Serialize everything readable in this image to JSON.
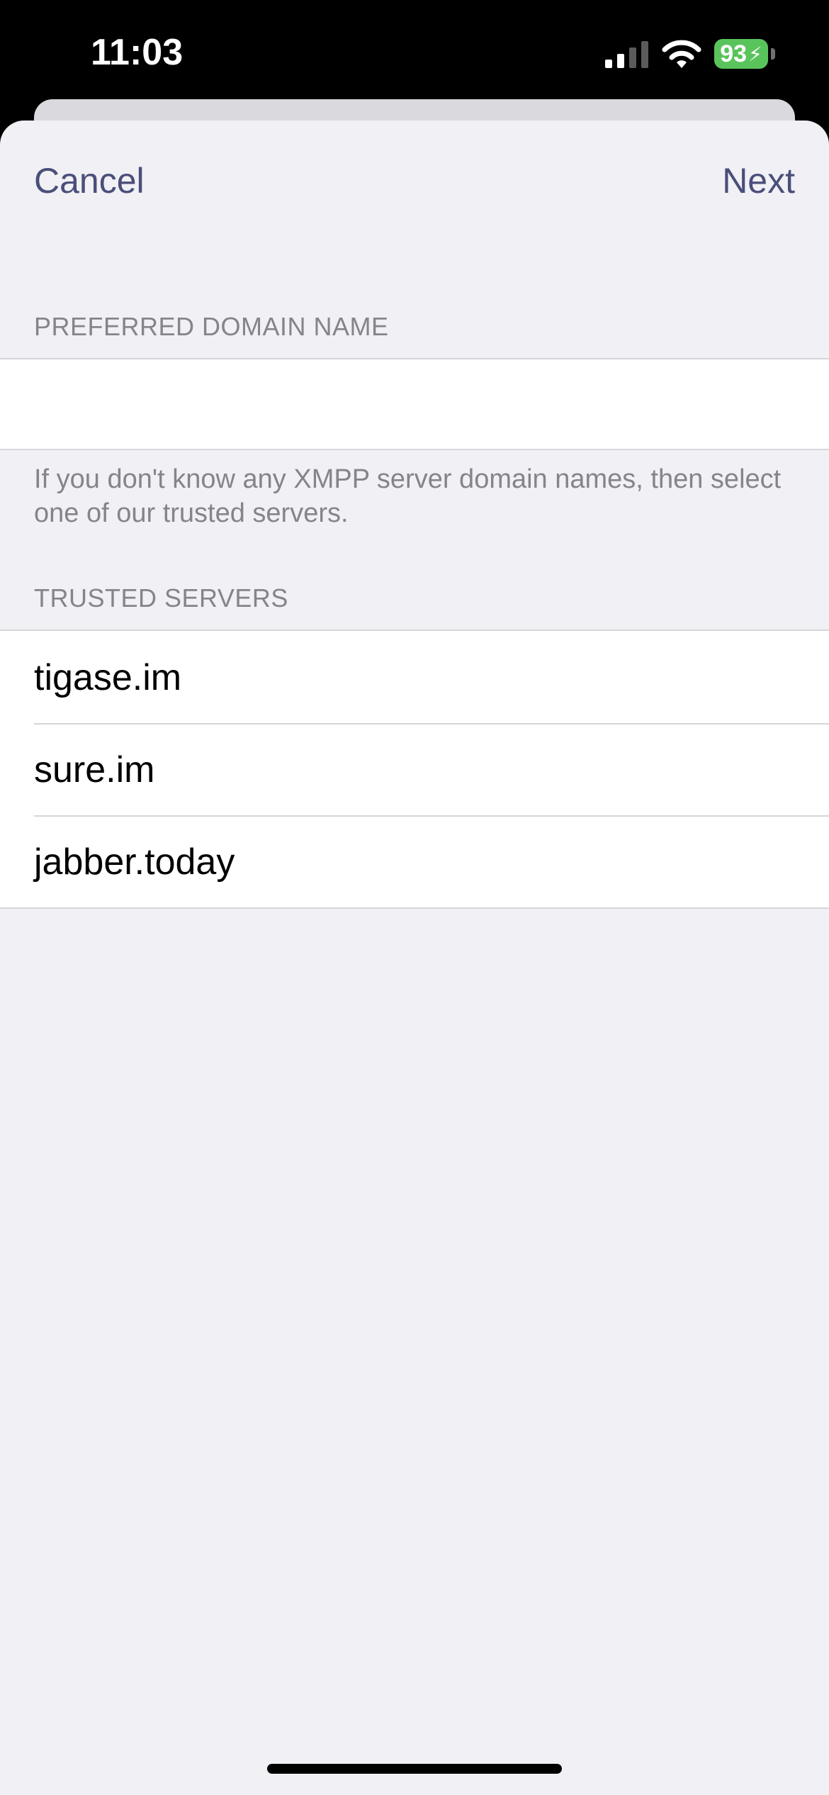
{
  "status_bar": {
    "time": "11:03",
    "battery_level": "93",
    "battery_color": "#5ac45c",
    "signal_icon": "cellular-signal-icon",
    "wifi_icon": "wifi-icon",
    "charging_icon": "bolt-icon"
  },
  "nav": {
    "cancel_label": "Cancel",
    "next_label": "Next"
  },
  "preferred_domain": {
    "header": "PREFERRED DOMAIN NAME",
    "value": "",
    "placeholder": "",
    "footer": "If you don't know any XMPP server domain names, then select one of our trusted servers."
  },
  "trusted_servers": {
    "header": "TRUSTED SERVERS",
    "items": [
      {
        "label": "tigase.im"
      },
      {
        "label": "sure.im"
      },
      {
        "label": "jabber.today"
      }
    ]
  },
  "colors": {
    "accent": "#4a4e79",
    "background": "#f0f0f5",
    "secondary_text": "#84848a"
  }
}
